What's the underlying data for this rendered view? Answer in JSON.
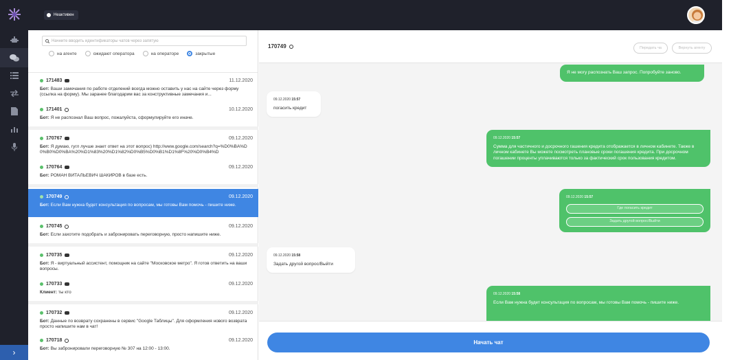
{
  "topbar": {
    "status_label": "Неактивен"
  },
  "rail": {
    "icons": [
      "robot-icon",
      "chats-icon",
      "list-icon",
      "transfer-icon",
      "document-icon",
      "stats-icon",
      "microphone-icon"
    ],
    "bottom_icon": "chevron-right-icon"
  },
  "filters": {
    "search_placeholder": "Начните вводить идентификаторы чатов через запятую",
    "options": [
      "на агенте",
      "ожидают оператора",
      "на операторе",
      "закрытые"
    ],
    "selected": "закрытые"
  },
  "chats": [
    {
      "id": "171483",
      "icon": "chat-icon",
      "date": "11.12.2020",
      "prefix": "Бот:",
      "text": "Ваши замечания по работе отделений всегда можно оставить у нас на сайте через форму (ссылка на форму). Мы заранее благодарим вас за конструктивные замечания и..."
    },
    {
      "id": "171401",
      "icon": "status-icon",
      "date": "10.12.2020",
      "prefix": "Бот:",
      "text": "Я не распознал Ваш вопрос, пожалуйста, сформулируйте его иначе."
    },
    {
      "id": "170767",
      "icon": "chat-icon",
      "date": "09.12.2020",
      "prefix": "Бот:",
      "text": "Я думаю, гугл лучше знает ответ на этот вопрос) http://www.google.com/search?q=%D0%BA%D0%B0%D0%BA%20%D1%83%20%D1%82%D0%B5%D0%B1%D1%8F%20%D0%B4%D"
    },
    {
      "id": "170764",
      "icon": "chat-icon",
      "date": "09.12.2020",
      "prefix": "Бот:",
      "text": "РОМАН ВИТАЛЬЕВИЧ ШАКИРОВ в базе есть."
    },
    {
      "id": "170749",
      "icon": "status-icon",
      "date": "09.12.2020",
      "prefix": "Бот:",
      "text": "Если Вам нужна будет консультация по вопросам, мы готовы Вам помочь - пишите ниже."
    },
    {
      "id": "170745",
      "icon": "status-icon",
      "date": "09.12.2020",
      "prefix": "Бот:",
      "text": "Если захотите подобрать и забронировать переговорную, просто напишите ниже."
    },
    {
      "id": "170735",
      "icon": "chat-icon",
      "date": "09.12.2020",
      "prefix": "Бот:",
      "text": "Я - виртуальный ассистент, помощник на сайте \"Московское метро\". Я готов ответить на ваши вопросы."
    },
    {
      "id": "170733",
      "icon": "chat-icon",
      "date": "09.12.2020",
      "prefix": "Клиент:",
      "text": "ты кто"
    },
    {
      "id": "170732",
      "icon": "chat-icon",
      "date": "09.12.2020",
      "prefix": "Бот:",
      "text": "Данные по возврату сохранены в сервис \"Google Таблицы\". Для оформления нового возврата просто напишите нам в чат!"
    },
    {
      "id": "170718",
      "icon": "status-icon",
      "date": "09.12.2020",
      "prefix": "Бот:",
      "text": "Вы забронировали переговорную № 307 на 12:00 - 13:00."
    }
  ],
  "selected_chat": "170749",
  "conversation": {
    "title": "170749",
    "btn_transfer": "Передать ча",
    "btn_return": "Вернуть агенту",
    "messages": [
      {
        "side": "bot",
        "text": "Я не могу распознать Ваш запрос. Попробуйте заново."
      },
      {
        "side": "user",
        "date": "09.12.2020",
        "time": "15:57",
        "text": "погасить кредит"
      },
      {
        "side": "bot",
        "date": "09.12.2020",
        "time": "15:57",
        "text": "Сумма для частичного и досрочного гашения кредита отображается в личном кабинете. Также в личном кабинете Вы можете посмотреть плановые сроки погашения кредита. При досрочном погашении проценты уплачиваются только за фактический срок пользования кредитом."
      },
      {
        "side": "bot",
        "date": "09.12.2020",
        "time": "15:57",
        "buttons": [
          "Где погасить кредит",
          "Задать другой вопрос/Выйти"
        ]
      },
      {
        "side": "user",
        "date": "09.12.2020",
        "time": "15:58",
        "text": "Задать другой вопрос/Выйти"
      },
      {
        "side": "bot",
        "date": "09.12.2020",
        "time": "15:58",
        "text": "Если Вам нужна будет консультация по вопросам, мы готовы Вам помочь - пишите ниже."
      }
    ],
    "start_label": "Начать чат"
  }
}
